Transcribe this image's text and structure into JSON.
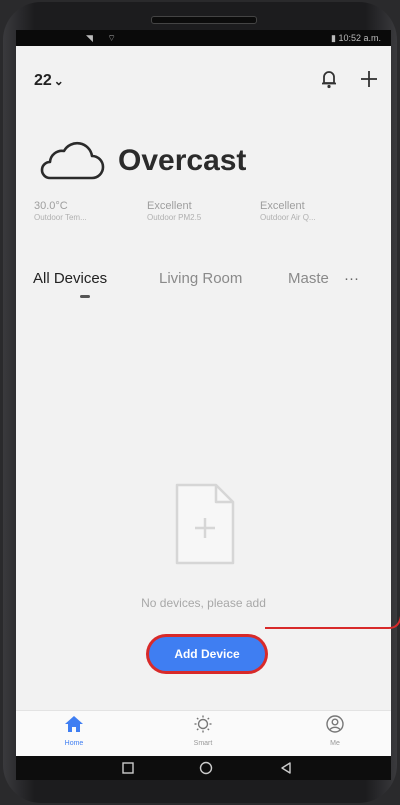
{
  "status_bar": {
    "left": "◥ ⌔",
    "right": "▮ 10:52 a.m."
  },
  "header": {
    "home_name": "22",
    "home_chevron": "⌄",
    "icons": [
      "doorbell-icon",
      "plus-icon"
    ]
  },
  "weather": {
    "condition": "Overcast",
    "icon": "cloud-icon",
    "stats": [
      {
        "value": "30.0°C",
        "label": "Outdoor Tem..."
      },
      {
        "value": "Excellent",
        "label": "Outdoor PM2.5"
      },
      {
        "value": "Excellent",
        "label": "Outdoor Air Q..."
      }
    ]
  },
  "tabs": {
    "items": [
      "All Devices",
      "Living Room",
      "Maste"
    ],
    "active": "All Devices",
    "more": "···"
  },
  "empty_state": {
    "icon": "empty-file-icon",
    "message": "No devices, please add",
    "button": "Add Device"
  },
  "bottom_nav": [
    {
      "label": "Home",
      "icon": "home-icon",
      "active": true
    },
    {
      "label": "Smart",
      "icon": "sun-icon",
      "active": false
    },
    {
      "label": "Me",
      "icon": "user-icon",
      "active": false
    }
  ],
  "system_nav": [
    "recent-apps-icon",
    "home-circle-icon",
    "back-icon"
  ],
  "colors": {
    "accent": "#3f7ef2",
    "highlight": "#d82a2a",
    "background": "#f2f2f2"
  }
}
